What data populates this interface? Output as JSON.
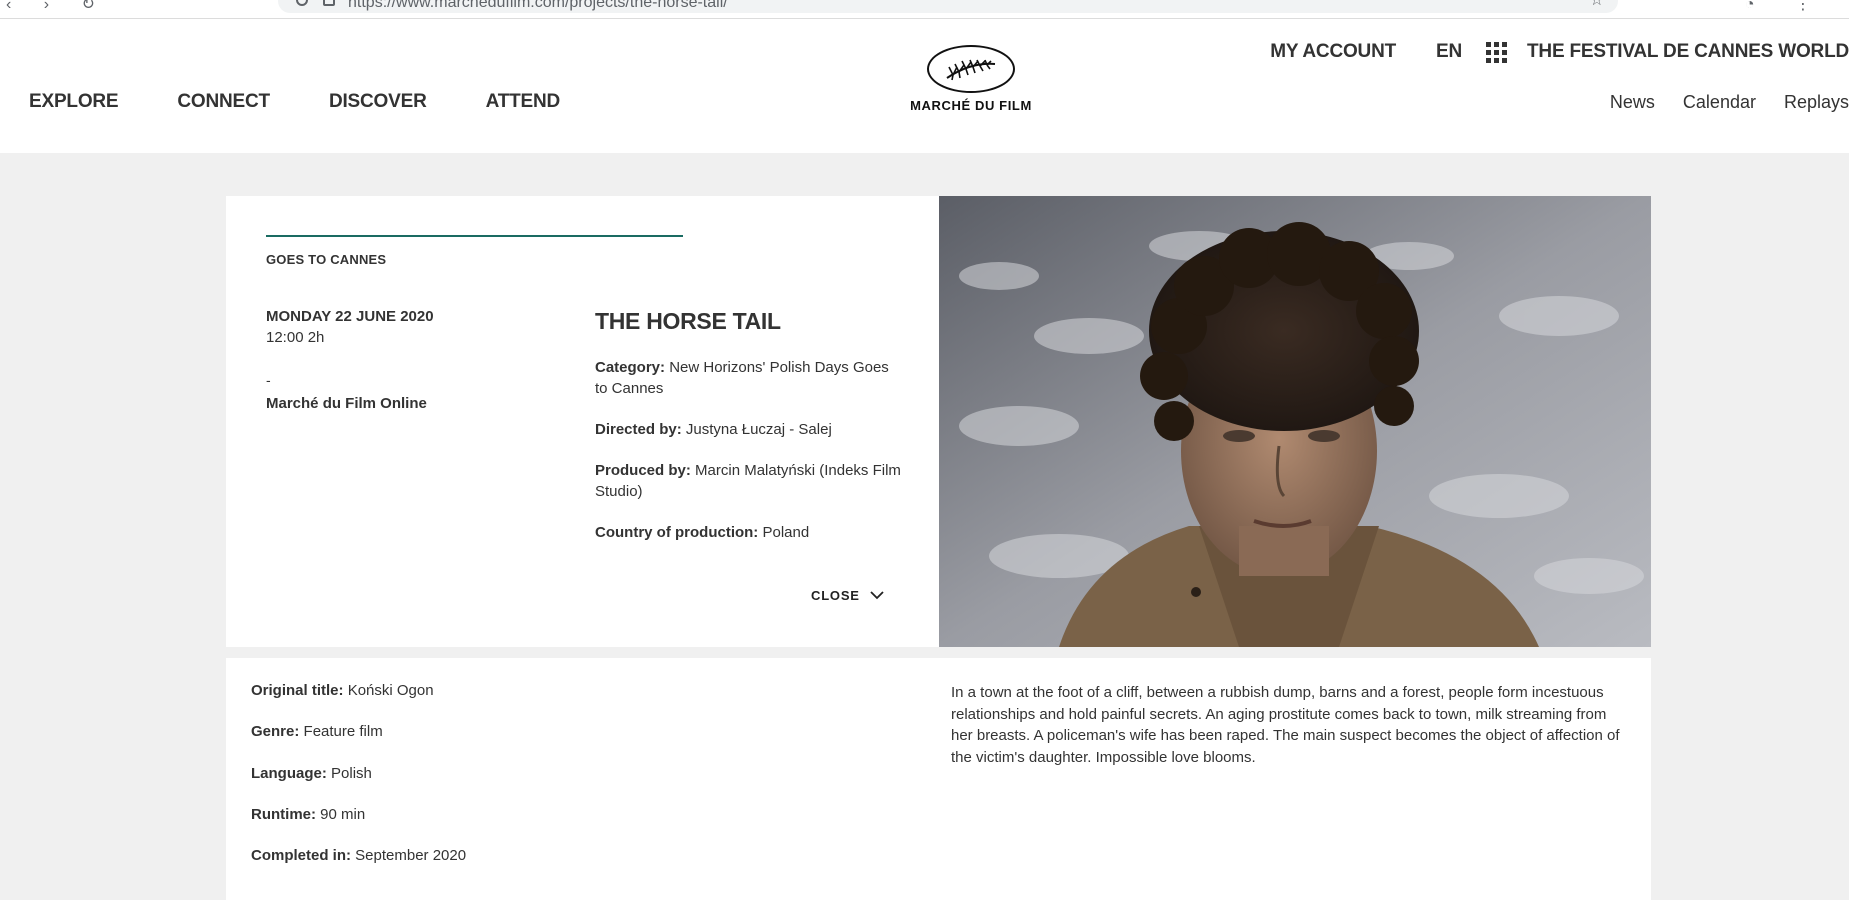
{
  "browser": {
    "url": "https://www.marchedufilm.com/projects/the-horse-tail/"
  },
  "header": {
    "nav": [
      "EXPLORE",
      "CONNECT",
      "DISCOVER",
      "ATTEND"
    ],
    "logo_text": "MARCHÉ DU FILM",
    "my_account": "MY ACCOUNT",
    "language": "EN",
    "festival_world": "THE FESTIVAL DE CANNES WORLD",
    "sub_links": [
      "News",
      "Calendar",
      "Replays"
    ]
  },
  "event": {
    "eyebrow": "GOES TO CANNES",
    "date": "MONDAY 22 JUNE 2020",
    "time": "12:00 2h",
    "dash": "-",
    "venue": "Marché du Film Online",
    "close_label": "CLOSE"
  },
  "film": {
    "title": "THE HORSE TAIL",
    "category_label": "Category:",
    "category": "New Horizons' Polish Days Goes to Cannes",
    "directed_label": "Directed by:",
    "directed": "Justyna Łuczaj - Salej",
    "produced_label": "Produced by:",
    "produced": "Marcin Malatyński (Indeks Film Studio)",
    "country_label": "Country of production:",
    "country": "Poland"
  },
  "details": {
    "original_title_label": "Original title:",
    "original_title": "Koński Ogon",
    "genre_label": "Genre:",
    "genre": "Feature film",
    "language_label": "Language:",
    "language": "Polish",
    "runtime_label": "Runtime:",
    "runtime": "90 min",
    "completed_label": "Completed in:",
    "completed": "September 2020",
    "synopsis": "In a town at the foot of a cliff, between a rubbish dump, barns and a forest, people form incestuous relationships and hold painful secrets. An aging prostitute comes back to town, milk streaming from her breasts. A policeman's wife has been raped. The main suspect becomes the object of affection of the victim's daughter. Impossible love blooms."
  },
  "colors": {
    "accent_teal": "#1a6b62",
    "page_bg": "#f0f0f0",
    "text": "#333333"
  }
}
